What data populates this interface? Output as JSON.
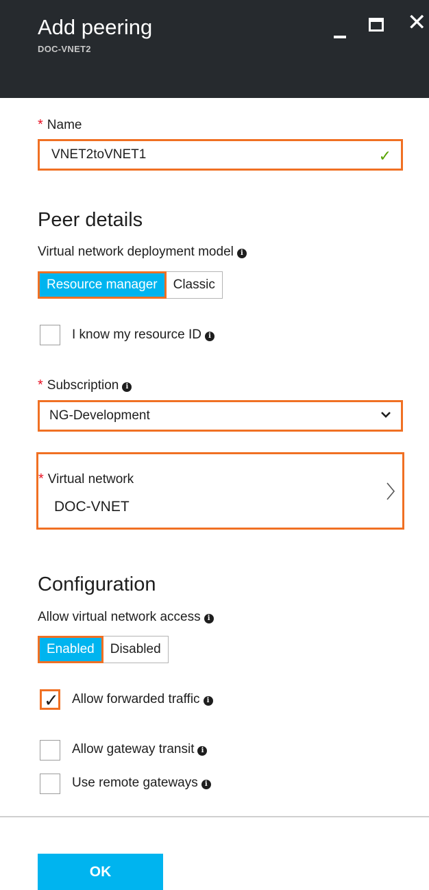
{
  "header": {
    "title": "Add peering",
    "subtitle": "DOC-VNET2"
  },
  "name_field": {
    "label": "Name",
    "value": "VNET2toVNET1"
  },
  "peer_details": {
    "section_title": "Peer details",
    "deployment_model_label": "Virtual network deployment model",
    "options": [
      "Resource manager",
      "Classic"
    ],
    "selected": "Resource manager",
    "resource_id_label": "I know my resource ID",
    "resource_id_checked": false
  },
  "subscription": {
    "label": "Subscription",
    "value": "NG-Development"
  },
  "virtual_network": {
    "label": "Virtual network",
    "value": "DOC-VNET"
  },
  "configuration": {
    "section_title": "Configuration",
    "access_label": "Allow virtual network access",
    "options": [
      "Enabled",
      "Disabled"
    ],
    "selected": "Enabled",
    "checkboxes": [
      {
        "label": "Allow forwarded traffic",
        "checked": true
      },
      {
        "label": "Allow gateway transit",
        "checked": false
      },
      {
        "label": "Use remote gateways",
        "checked": false
      }
    ]
  },
  "footer": {
    "ok_label": "OK"
  },
  "colors": {
    "header_bg": "#262a2e",
    "accent": "#00b4ef",
    "highlight": "#f07023",
    "required": "#e81123",
    "valid_check": "#57a300"
  }
}
